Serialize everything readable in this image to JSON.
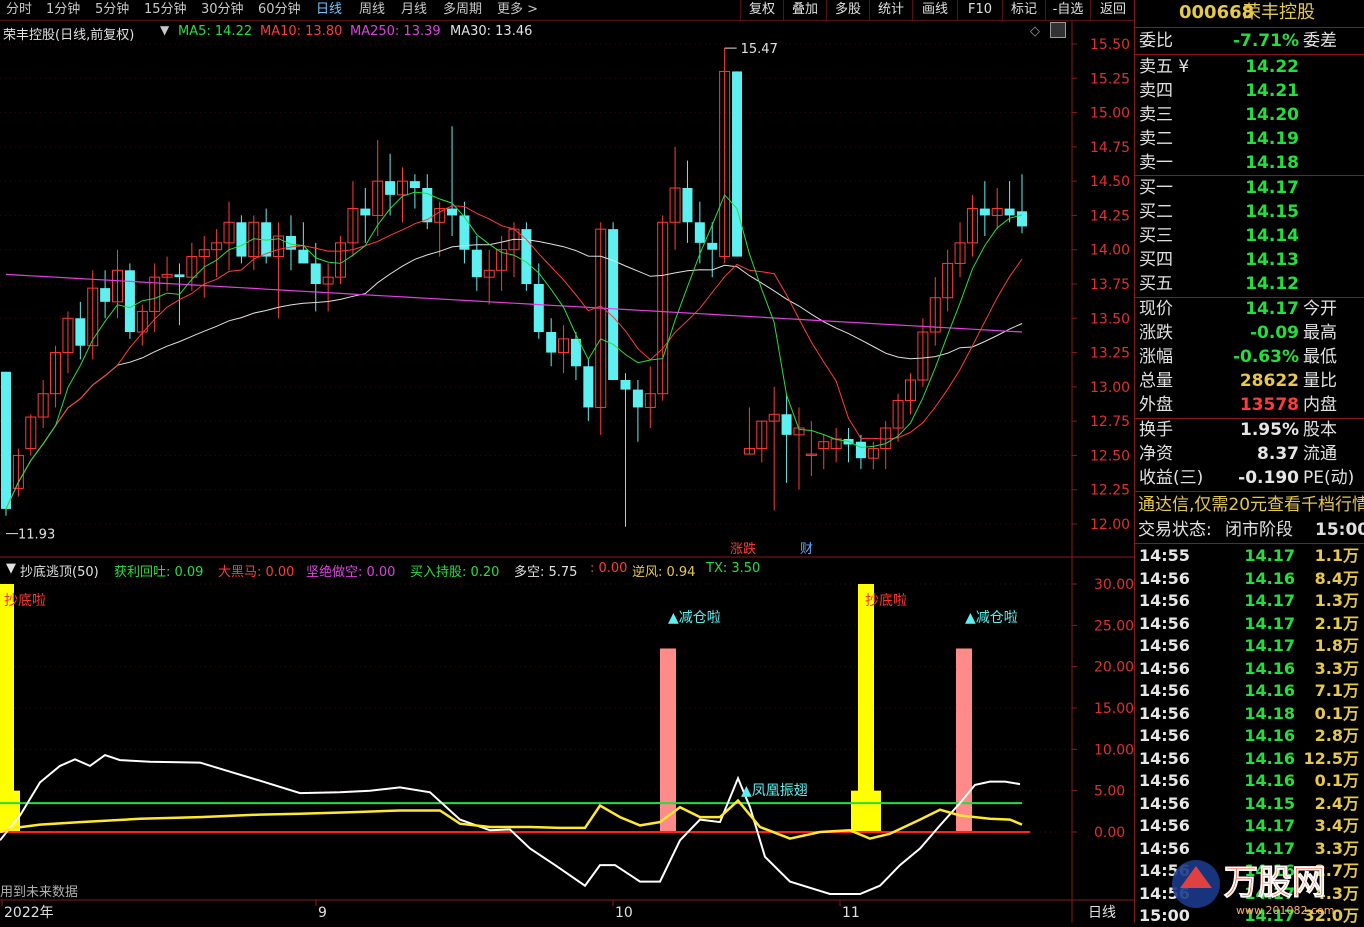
{
  "toolbar": {
    "periods": [
      "分时",
      "1分钟",
      "5分钟",
      "15分钟",
      "30分钟",
      "60分钟",
      "日线",
      "周线",
      "月线",
      "多周期",
      "更多 >"
    ],
    "active_period": "日线",
    "actions": [
      "复权",
      "叠加",
      "多股",
      "统计",
      "画线",
      "F10",
      "标记",
      "-自选",
      "返回"
    ]
  },
  "main_chart": {
    "title": "荣丰控股(日线,前复权)",
    "ma_labels": [
      {
        "text": "MA5: 14.22",
        "color": "#22e03c"
      },
      {
        "text": "MA10: 13.80",
        "color": "#ff3b3b"
      },
      {
        "text": "MA250: 13.39",
        "color": "#e040e0"
      },
      {
        "text": "MA30: 13.46",
        "color": "#e0e0e0"
      }
    ],
    "high_label": "15.47",
    "low_label": "11.93",
    "price_axis": [
      "15.50",
      "15.25",
      "15.00",
      "14.75",
      "14.50",
      "14.25",
      "14.00",
      "13.75",
      "13.50",
      "13.25",
      "13.00",
      "12.75",
      "12.50",
      "12.25",
      "12.00"
    ],
    "event_markers": [
      {
        "text": "涨跌",
        "color": "#ff3b3b"
      },
      {
        "text": "财",
        "color": "#5ea8ff"
      }
    ]
  },
  "chart_data": {
    "type": "candlestick",
    "ohlc": [
      [
        13.11,
        13.11,
        12.06,
        12.11
      ],
      [
        12.26,
        12.55,
        12.2,
        12.5
      ],
      [
        12.55,
        12.8,
        12.5,
        12.78
      ],
      [
        12.78,
        13.05,
        12.7,
        12.95
      ],
      [
        12.95,
        13.3,
        12.85,
        13.25
      ],
      [
        13.25,
        13.55,
        13.1,
        13.5
      ],
      [
        13.5,
        13.62,
        13.2,
        13.3
      ],
      [
        13.3,
        13.85,
        13.2,
        13.72
      ],
      [
        13.72,
        13.85,
        13.5,
        13.62
      ],
      [
        13.62,
        14.0,
        13.5,
        13.85
      ],
      [
        13.85,
        13.9,
        13.35,
        13.4
      ],
      [
        13.4,
        13.6,
        13.3,
        13.55
      ],
      [
        13.55,
        13.9,
        13.4,
        13.8
      ],
      [
        13.8,
        13.95,
        13.7,
        13.82
      ],
      [
        13.82,
        13.9,
        13.45,
        13.8
      ],
      [
        13.8,
        14.05,
        13.7,
        13.95
      ],
      [
        13.95,
        14.1,
        13.65,
        14.0
      ],
      [
        14.0,
        14.15,
        13.8,
        14.05
      ],
      [
        14.05,
        14.35,
        13.85,
        14.2
      ],
      [
        14.2,
        14.25,
        13.9,
        13.95
      ],
      [
        13.95,
        14.25,
        13.85,
        14.2
      ],
      [
        14.2,
        14.3,
        13.9,
        13.95
      ],
      [
        13.95,
        14.2,
        13.5,
        14.1
      ],
      [
        14.1,
        14.25,
        13.85,
        14.0
      ],
      [
        14.0,
        14.2,
        13.9,
        13.9
      ],
      [
        13.9,
        14.05,
        13.55,
        13.75
      ],
      [
        13.75,
        13.9,
        13.55,
        13.8
      ],
      [
        13.8,
        14.1,
        13.75,
        14.05
      ],
      [
        14.05,
        14.5,
        13.95,
        14.3
      ],
      [
        14.3,
        14.45,
        14.05,
        14.25
      ],
      [
        14.25,
        14.8,
        14.1,
        14.5
      ],
      [
        14.5,
        14.7,
        14.25,
        14.4
      ],
      [
        14.4,
        14.6,
        14.2,
        14.5
      ],
      [
        14.5,
        14.55,
        14.3,
        14.45
      ],
      [
        14.45,
        14.55,
        14.15,
        14.2
      ],
      [
        14.2,
        14.35,
        13.95,
        14.3
      ],
      [
        14.3,
        14.9,
        14.1,
        14.25
      ],
      [
        14.25,
        14.35,
        13.9,
        14.0
      ],
      [
        14.0,
        14.1,
        13.7,
        13.8
      ],
      [
        13.8,
        14.0,
        13.6,
        13.85
      ],
      [
        13.85,
        14.1,
        13.7,
        14.0
      ],
      [
        14.0,
        14.2,
        13.8,
        14.15
      ],
      [
        14.15,
        14.2,
        13.7,
        13.75
      ],
      [
        13.75,
        13.9,
        13.35,
        13.4
      ],
      [
        13.4,
        13.5,
        13.15,
        13.25
      ],
      [
        13.25,
        13.45,
        13.1,
        13.35
      ],
      [
        13.35,
        13.4,
        13.05,
        13.15
      ],
      [
        13.15,
        13.2,
        12.75,
        12.85
      ],
      [
        12.85,
        14.2,
        12.65,
        14.15
      ],
      [
        14.15,
        14.2,
        13.05,
        13.05
      ],
      [
        13.05,
        13.1,
        11.98,
        12.98
      ],
      [
        12.98,
        13.05,
        12.6,
        12.85
      ],
      [
        12.85,
        13.15,
        12.7,
        12.95
      ],
      [
        12.95,
        14.25,
        12.9,
        14.2
      ],
      [
        14.2,
        14.75,
        14.0,
        14.45
      ],
      [
        14.45,
        14.65,
        14.05,
        14.2
      ],
      [
        14.2,
        14.35,
        13.9,
        14.05
      ],
      [
        14.05,
        14.2,
        13.8,
        14.0
      ],
      [
        13.95,
        15.47,
        13.9,
        15.3
      ],
      [
        15.3,
        15.3,
        13.95,
        13.95
      ],
      [
        12.51,
        12.85,
        12.51,
        12.55
      ],
      [
        12.55,
        12.75,
        12.45,
        12.75
      ],
      [
        12.75,
        13.0,
        12.1,
        12.8
      ],
      [
        12.8,
        12.95,
        12.3,
        12.65
      ],
      [
        12.65,
        12.85,
        12.25,
        12.7
      ],
      [
        12.5,
        12.75,
        12.35,
        12.51
      ],
      [
        12.55,
        12.65,
        12.4,
        12.6
      ],
      [
        12.55,
        12.7,
        12.45,
        12.62
      ],
      [
        12.62,
        12.7,
        12.45,
        12.58
      ],
      [
        12.6,
        12.65,
        12.4,
        12.48
      ],
      [
        12.48,
        12.6,
        12.4,
        12.55
      ],
      [
        12.55,
        12.75,
        12.4,
        12.7
      ],
      [
        12.7,
        12.95,
        12.6,
        12.9
      ],
      [
        12.9,
        13.1,
        12.8,
        13.05
      ],
      [
        13.05,
        13.5,
        13.0,
        13.4
      ],
      [
        13.4,
        13.8,
        13.3,
        13.65
      ],
      [
        13.65,
        14.0,
        13.55,
        13.9
      ],
      [
        13.9,
        14.2,
        13.8,
        14.05
      ],
      [
        14.05,
        14.4,
        13.95,
        14.3
      ],
      [
        14.3,
        14.5,
        14.1,
        14.25
      ],
      [
        14.25,
        14.45,
        14.15,
        14.3
      ],
      [
        14.3,
        14.5,
        14.2,
        14.25
      ],
      [
        14.28,
        14.55,
        14.12,
        14.17
      ]
    ],
    "ma_series": [
      {
        "name": "MA5",
        "color": "#22e03c"
      },
      {
        "name": "MA10",
        "color": "#ff3b3b"
      },
      {
        "name": "MA250",
        "color": "#e040e0"
      },
      {
        "name": "MA30",
        "color": "#e0e0e0"
      }
    ],
    "ylim": [
      11.85,
      15.6
    ],
    "x_labels": [
      "2022年",
      "9",
      "10",
      "11"
    ]
  },
  "indicator": {
    "title": "抄底逃顶(50)",
    "labels": [
      {
        "text": "获利回吐: 0.09",
        "color": "#22e03c"
      },
      {
        "text": "大黑马: 0.00",
        "color": "#ff3b3b"
      },
      {
        "text": "坚绝做空: 0.00",
        "color": "#e040e0"
      },
      {
        "text": "买入持股: 0.20",
        "color": "#22e03c"
      },
      {
        "text": "多空: 5.75",
        "color": "#e0e0e0"
      },
      {
        "text": ": 0.00",
        "color": "#ff3b3b"
      },
      {
        "text": "逆风: 0.94",
        "color": "#e6c84a"
      },
      {
        "text": "TX: 3.50",
        "color": "#22e03c"
      }
    ],
    "axis": [
      "30.00",
      "25.00",
      "20.00",
      "15.00",
      "10.00",
      "5.00",
      "0.00"
    ],
    "signals": {
      "bottom": "抄底啦",
      "reduce": "减仓啦",
      "phoenix": "凤凰振翅"
    },
    "footnote": "用到未来数据"
  },
  "bottom_axis_label": "日线",
  "right_panel": {
    "code": "000668",
    "name": "荣丰控股",
    "webi": {
      "label": "委比",
      "value": "-7.71%",
      "label2": "委差"
    },
    "asks": [
      {
        "label": "卖五",
        "mark": "¥",
        "price": "14.22"
      },
      {
        "label": "卖四",
        "price": "14.21"
      },
      {
        "label": "卖三",
        "price": "14.20"
      },
      {
        "label": "卖二",
        "price": "14.19"
      },
      {
        "label": "卖一",
        "price": "14.18"
      }
    ],
    "bids": [
      {
        "label": "买一",
        "price": "14.17"
      },
      {
        "label": "买二",
        "price": "14.15"
      },
      {
        "label": "买三",
        "price": "14.14"
      },
      {
        "label": "买四",
        "price": "14.13"
      },
      {
        "label": "买五",
        "price": "14.12"
      }
    ],
    "stats": [
      {
        "label": "现价",
        "value": "14.17",
        "color": "#22e03c",
        "label2": "今开"
      },
      {
        "label": "涨跌",
        "value": "-0.09",
        "color": "#22e03c",
        "label2": "最高"
      },
      {
        "label": "涨幅",
        "value": "-0.63%",
        "color": "#22e03c",
        "label2": "最低"
      },
      {
        "label": "总量",
        "value": "28622",
        "color": "#e6c84a",
        "label2": "量比"
      },
      {
        "label": "外盘",
        "value": "13578",
        "color": "#ff3b3b",
        "label2": "内盘"
      }
    ],
    "stats2": [
      {
        "label": "换手",
        "value": "1.95%",
        "label2": "股本"
      },
      {
        "label": "净资",
        "value": "8.37",
        "label2": "流通"
      },
      {
        "label": "收益(三)",
        "value": "-0.190",
        "label2": "PE(动)"
      }
    ],
    "ad_text": "通达信,仅需20元查看千档行情",
    "trade_status": {
      "label": "交易状态:",
      "status": "闭市阶段",
      "time": "15:00:"
    },
    "ticks": [
      {
        "time": "14:55",
        "price": "14.17",
        "vol": "1.1",
        "unit": "万",
        "pc": "#22e03c"
      },
      {
        "time": "14:56",
        "price": "14.16",
        "vol": "8.4",
        "unit": "万",
        "pc": "#22e03c"
      },
      {
        "time": "14:56",
        "price": "14.17",
        "vol": "1.3",
        "unit": "万",
        "pc": "#22e03c"
      },
      {
        "time": "14:56",
        "price": "14.17",
        "vol": "2.1",
        "unit": "万",
        "pc": "#22e03c"
      },
      {
        "time": "14:56",
        "price": "14.17",
        "vol": "1.8",
        "unit": "万",
        "pc": "#22e03c"
      },
      {
        "time": "14:56",
        "price": "14.16",
        "vol": "3.3",
        "unit": "万",
        "pc": "#22e03c"
      },
      {
        "time": "14:56",
        "price": "14.16",
        "vol": "7.1",
        "unit": "万",
        "pc": "#22e03c"
      },
      {
        "time": "14:56",
        "price": "14.18",
        "vol": "0.1",
        "unit": "万",
        "pc": "#22e03c"
      },
      {
        "time": "14:56",
        "price": "14.16",
        "vol": "2.8",
        "unit": "万",
        "pc": "#22e03c"
      },
      {
        "time": "14:56",
        "price": "14.16",
        "vol": "12.5",
        "unit": "万",
        "pc": "#22e03c"
      },
      {
        "time": "14:56",
        "price": "14.16",
        "vol": "0.1",
        "unit": "万",
        "pc": "#22e03c"
      },
      {
        "time": "14:56",
        "price": "14.15",
        "vol": "2.4",
        "unit": "万",
        "pc": "#22e03c"
      },
      {
        "time": "14:56",
        "price": "14.17",
        "vol": "3.4",
        "unit": "万",
        "pc": "#22e03c"
      },
      {
        "time": "14:56",
        "price": "14.17",
        "vol": "3.3",
        "unit": "万",
        "pc": "#22e03c"
      },
      {
        "time": "14:56",
        "price": "14.16",
        "vol": "2.7",
        "unit": "万",
        "pc": "#22e03c"
      },
      {
        "time": "14:56",
        "price": "14.17",
        "vol": "4.3",
        "unit": "万",
        "pc": "#22e03c"
      },
      {
        "time": "15:00",
        "price": "14.17",
        "vol": "32.0",
        "unit": "万",
        "pc": "#22e03c"
      }
    ]
  },
  "watermark": {
    "brand": "万股网",
    "url": "www.201082.com"
  }
}
